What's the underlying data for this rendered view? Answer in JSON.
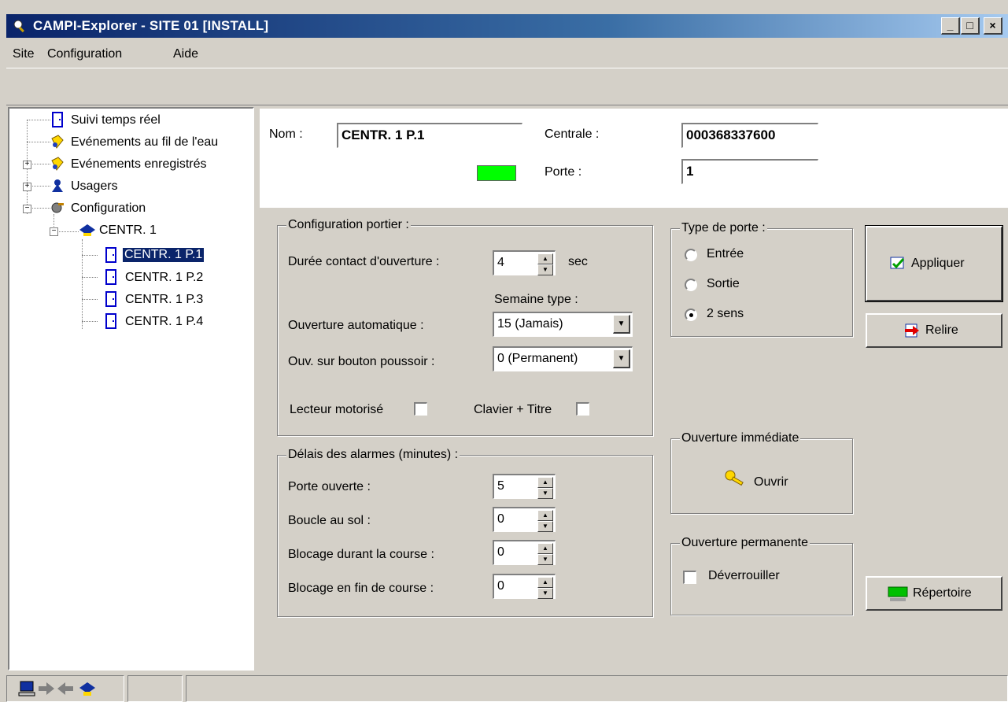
{
  "window": {
    "title": "CAMPI-Explorer - SITE 01 [INSTALL]",
    "min": "_",
    "max": "□",
    "close": "×"
  },
  "menu": [
    "Site",
    "Configuration",
    "Aide"
  ],
  "tree": {
    "items": [
      {
        "label": "Suivi temps réel",
        "icon": "door-icon"
      },
      {
        "label": "Evénements au fil de l'eau",
        "icon": "event-icon"
      },
      {
        "label": "Evénements enregistrés",
        "icon": "event-icon"
      },
      {
        "label": "Usagers",
        "icon": "users-icon"
      },
      {
        "label": "Configuration",
        "icon": "config-icon"
      },
      {
        "label": "CENTR. 1",
        "icon": "central-icon"
      },
      {
        "label": "CENTR. 1 P.1",
        "icon": "door-icon"
      },
      {
        "label": "CENTR. 1 P.2",
        "icon": "door-icon"
      },
      {
        "label": "CENTR. 1 P.3",
        "icon": "door-icon"
      },
      {
        "label": "CENTR. 1 P.4",
        "icon": "door-icon"
      }
    ]
  },
  "header": {
    "nom_label": "Nom :",
    "nom_value": "CENTR. 1 P.1",
    "centrale_label": "Centrale :",
    "centrale_value": "000368337600",
    "porte_label": "Porte :",
    "porte_value": "1",
    "status_color": "#00ff00"
  },
  "config_portier": {
    "title": "Configuration portier :",
    "duree_label": "Durée contact d'ouverture :",
    "duree_value": "4",
    "duree_unit": "sec",
    "semaine_label": "Semaine type :",
    "auto_label": "Ouverture automatique :",
    "auto_value": "15 (Jamais)",
    "bouton_label": "Ouv. sur bouton poussoir :",
    "bouton_value": "0 (Permanent)",
    "lecteur_label": "Lecteur motorisé",
    "clavier_label": "Clavier + Titre"
  },
  "delais": {
    "title": "Délais des alarmes (minutes) :",
    "rows": [
      {
        "label": "Porte ouverte :",
        "value": "5"
      },
      {
        "label": "Boucle au sol :",
        "value": "0"
      },
      {
        "label": "Blocage durant la course :",
        "value": "0"
      },
      {
        "label": "Blocage en fin de course :",
        "value": "0"
      }
    ]
  },
  "type_porte": {
    "title": "Type de porte :",
    "options": [
      "Entrée",
      "Sortie",
      "2 sens"
    ],
    "selected": "2 sens"
  },
  "ouverture_immediate": {
    "title": "Ouverture immédiate",
    "button": "Ouvrir"
  },
  "ouverture_permanente": {
    "title": "Ouverture permanente",
    "checkbox": "Déverrouiller"
  },
  "buttons": {
    "appliquer": "Appliquer",
    "relire": "Relire",
    "repertoire": "Répertoire"
  }
}
